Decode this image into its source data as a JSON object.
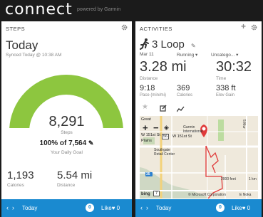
{
  "header": {
    "logo": "connect",
    "powered": "powered by Garmin"
  },
  "steps_card": {
    "title": "STEPS",
    "day": "Today",
    "synced": "Synced Today @ 10:38 AM",
    "steps_value": "8,291",
    "steps_label": "Steps",
    "goal_percent": "100% of 7,564",
    "goal_label": "Your Daily Goal",
    "goal_fraction": 1.0,
    "calories_value": "1,193",
    "calories_label": "Calories",
    "distance_value": "5.54 mi",
    "distance_label": "Distance",
    "gauge_color": "#8dc63f",
    "footer": {
      "day": "Today",
      "comments": "0",
      "like": "Like",
      "likes": "0"
    }
  },
  "activities_card": {
    "title": "ACTIVITIES",
    "activity_name": "3 Loop",
    "date": "Mar 11",
    "type": "Running",
    "category": "Uncatego...",
    "distance_value": "3.28 mi",
    "distance_label": "Distance",
    "time_value": "30:32",
    "time_label": "Time",
    "pace_value": "9:18",
    "pace_label": "Pace (min/mi)",
    "calories_value": "369",
    "calories_label": "Calories",
    "elev_value": "338 ft",
    "elev_label": "Elev Gain",
    "map": {
      "label_great": "Great",
      "label_garmin": "Garmin International",
      "label_southgate": "Southgate Retail Center",
      "label_street1": "W 151st St",
      "label_street2": "W 151st St",
      "label_plains": "Plains",
      "label_5mur": "5 Mur",
      "road_56": "56",
      "road_35": "35",
      "road_7": "7",
      "scale_feet": "2000 feet",
      "scale_km": "1 km",
      "copyright": "© Microsoft Corporation",
      "street3": "E Noka",
      "bing": "bing"
    },
    "footer": {
      "day": "Today",
      "comments": "0",
      "like": "Like",
      "likes": "0"
    }
  },
  "colors": {
    "accent": "#1a8ad0",
    "gauge": "#8dc63f",
    "route": "#e03a3a"
  }
}
